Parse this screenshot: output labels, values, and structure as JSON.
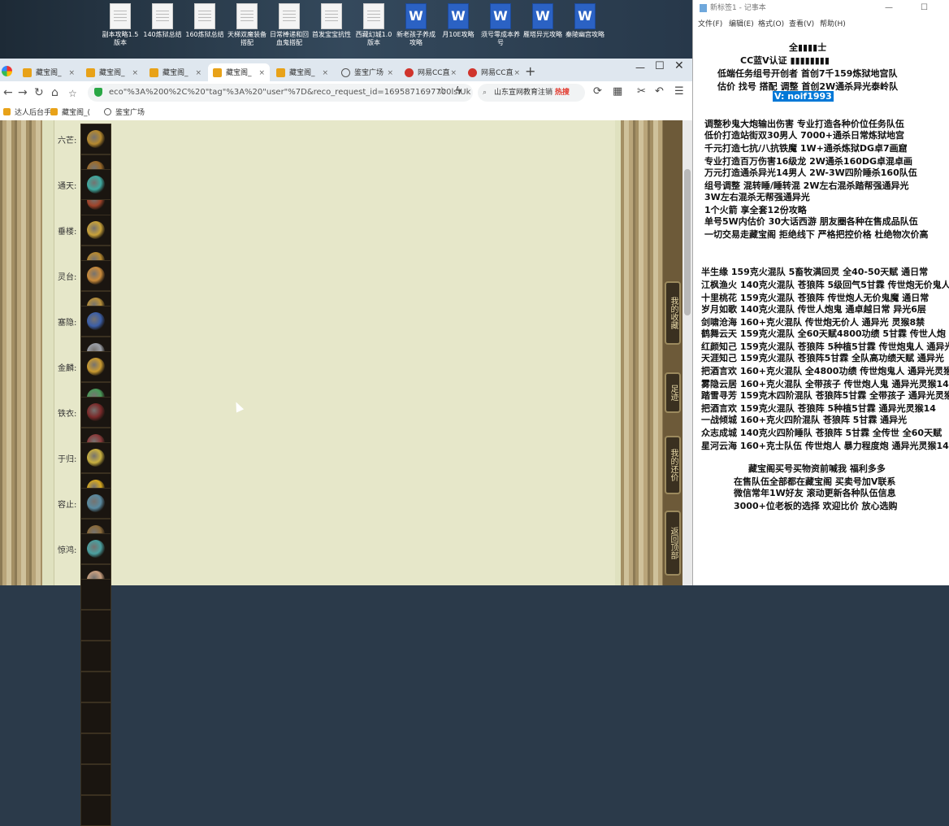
{
  "desktop": {
    "icons": [
      {
        "label": "副本攻略1.5版本",
        "type": "doc"
      },
      {
        "label": "140炼狱总结",
        "type": "doc"
      },
      {
        "label": "160炼狱总结",
        "type": "doc"
      },
      {
        "label": "天梯双魔装备搭配",
        "type": "doc"
      },
      {
        "label": "日常棒递和回血鬼搭配",
        "type": "doc"
      },
      {
        "label": "首发宝宝抗性",
        "type": "doc"
      },
      {
        "label": "西藏幻城1.0版本",
        "type": "doc"
      },
      {
        "label": "新老孩子养成攻略",
        "type": "word"
      },
      {
        "label": "月10E攻略",
        "type": "word"
      },
      {
        "label": "须号零成本养号",
        "type": "word"
      },
      {
        "label": "雁塔异光攻略",
        "type": "word"
      },
      {
        "label": "秦陵幽宫攻略",
        "type": "word"
      }
    ]
  },
  "browser": {
    "tabs": [
      {
        "label": "藏宝阁_",
        "icon": "treasure"
      },
      {
        "label": "藏宝阁_",
        "icon": "treasure"
      },
      {
        "label": "藏宝阁_",
        "icon": "treasure"
      },
      {
        "label": "藏宝阁_",
        "icon": "treasure"
      },
      {
        "label": "藏宝阁_",
        "icon": "treasure"
      },
      {
        "label": "鉴宝广场",
        "icon": "globe"
      },
      {
        "label": "网易CC直",
        "icon": "net"
      },
      {
        "label": "网易CC直",
        "icon": "net"
      }
    ],
    "new_tab": "+",
    "address": "eco\"%3A%200%2C%20\"tag\"%3A%20\"user\"%7D&reco_request_id=1695871697700lslUk",
    "search_text": "山东宣网教育注销",
    "search_hot": "热搜",
    "bookmarks": [
      "达人后台手",
      "藏宝阁_(",
      "鉴宝广场"
    ]
  },
  "page": {
    "rows": [
      {
        "label": "六芒:",
        "count": 3,
        "colors": [
          "#b5892f",
          "#9c6b2a",
          "#a0432a"
        ]
      },
      {
        "label": "通天:",
        "count": 1,
        "colors": [
          "#3fa9a0"
        ]
      },
      {
        "label": "垂楼:",
        "count": 4,
        "colors": [
          "#c9a23a",
          "#b88a30",
          "#d6b440",
          "#c99a30"
        ]
      },
      {
        "label": "灵台:",
        "count": 4,
        "colors": [
          "#c98a3a",
          "#b8903a",
          "#9aa4b0",
          "#a63a3a"
        ]
      },
      {
        "label": "塞隐:",
        "count": 3,
        "colors": [
          "#3c5fa8",
          "#9ca0a8",
          "#2c3f8a"
        ]
      },
      {
        "label": "金麟:",
        "count": 3,
        "colors": [
          "#c99a30",
          "#4a9a5a",
          "#8a8a8a"
        ]
      },
      {
        "label": "铁衣:",
        "count": 3,
        "colors": [
          "#7a2a2a",
          "#8a3a3a",
          "#6a2a3a"
        ]
      },
      {
        "label": "于归:",
        "count": 5,
        "colors": [
          "#c9b040",
          "#d6a820",
          "#c9a030",
          "#d6a020",
          "#a0a0a0"
        ]
      },
      {
        "label": "容止:",
        "count": 5,
        "colors": [
          "#5a8aa0",
          "#8a6a3a",
          "#c9a040",
          "#4a7ab0",
          "#6aa0c0"
        ]
      },
      {
        "label": "惊鸿:",
        "count": 5,
        "colors": [
          "#4aa0a0",
          "#c9a080",
          "#6a9aa0",
          "#c04a8a",
          "#3aa070"
        ]
      }
    ],
    "side_buttons": [
      "我的收藏",
      "足迹",
      "我的还价",
      "返回顶部"
    ]
  },
  "notepad": {
    "title": "新标签1 - 记事本",
    "menu": [
      "文件(F)",
      "编辑(E)",
      "格式(O)",
      "查看(V)",
      "帮助(H)"
    ],
    "lines": [
      "全▮▮▮▮士",
      "CC蓝V认证 ▮▮▮▮▮▮▮▮",
      "低端任务组号开创者          首创7千159炼狱地宫队",
      "估价 找号 搭配 调整        首创2W通杀异光泰岭队",
      "V: noif1993",
      "调整秒鬼大炮输出伤害          专业打造各种价位任务队伍",
      "低价打造站街双30男人            7000+通杀日常炼狱地宫",
      "千元打造七抗/八抗铁魔          1W+通杀炼狱DG卓7画窟",
      "专业打造百万伤害16级龙           2W通杀160DG卓混卓画",
      "万元打造通杀异光14男人          2W-3W四阶睡杀160队伍",
      "组号调整 混转睡/睡转混           2W左右混杀踏帮强通异光",
      "                                          3W左右混杀无帮强通异光",
      "1个火箭 享全套12份攻略",
      "单号5W内估价 30大话西游         朋友圈各种在售成品队伍",
      "一切交易走藏宝阁 拒绝线下     严格把控价格 杜绝物次价高",
      "半生缘    159克火混队 5畜牧满回灵 全40-50天赋 通日常",
      "江枫渔火 140克火混队 苍狼阵 5级回气5甘霖 传世炮无价鬼人",
      "十里桃花 159克火混队 苍狼阵 传世炮人无价鬼魔 通日常",
      "岁月如歌 140克火混队 传世人炮鬼 通卓越日常 异光6层",
      "剑啸沧海 160+克火混队 传世炮无价人 通异光 灵猴8禁",
      "鹤舞云天 159克火混队 全60天赋4800功绩 5甘霖 传世人炮",
      "红颜知己 159克火混队 苍狼阵 5种植5甘霖 传世炮鬼人 通异光",
      "天涯知己 159克火混队 苍狼阵5甘霖 全队高功绩天赋 通异光",
      "把酒言欢 160+克火混队 全4800功绩 传世炮鬼人 通异光灵猴",
      "雾隐云居 160+克火混队 全带孩子 传世炮人鬼 通异光灵猴14",
      "踏雪寻芳 159克木四阶混队 苍狼阵5甘霖 全带孩子 通异光灵猴",
      "把酒言欢 159克火混队 苍狼阵 5种植5甘霖 通异光灵猴14",
      "一战倾城 160+克火四阶混队 苍狼阵 5甘霖 通异光",
      "众志成城 140克火四阶睡队 苍狼阵 5甘霖 全传世 全60天赋",
      "星河云海 160+克士队伍 传世炮人 暴力程度炮 通异光灵猴14",
      "藏宝阁买号买物资前喊我 福利多多",
      "在售队伍全部都在藏宝阁 买卖号加V联系",
      "微信常年1W好友 滚动更新各种队伍信息",
      "3000+位老板的选择 欢迎比价 放心选购"
    ]
  }
}
